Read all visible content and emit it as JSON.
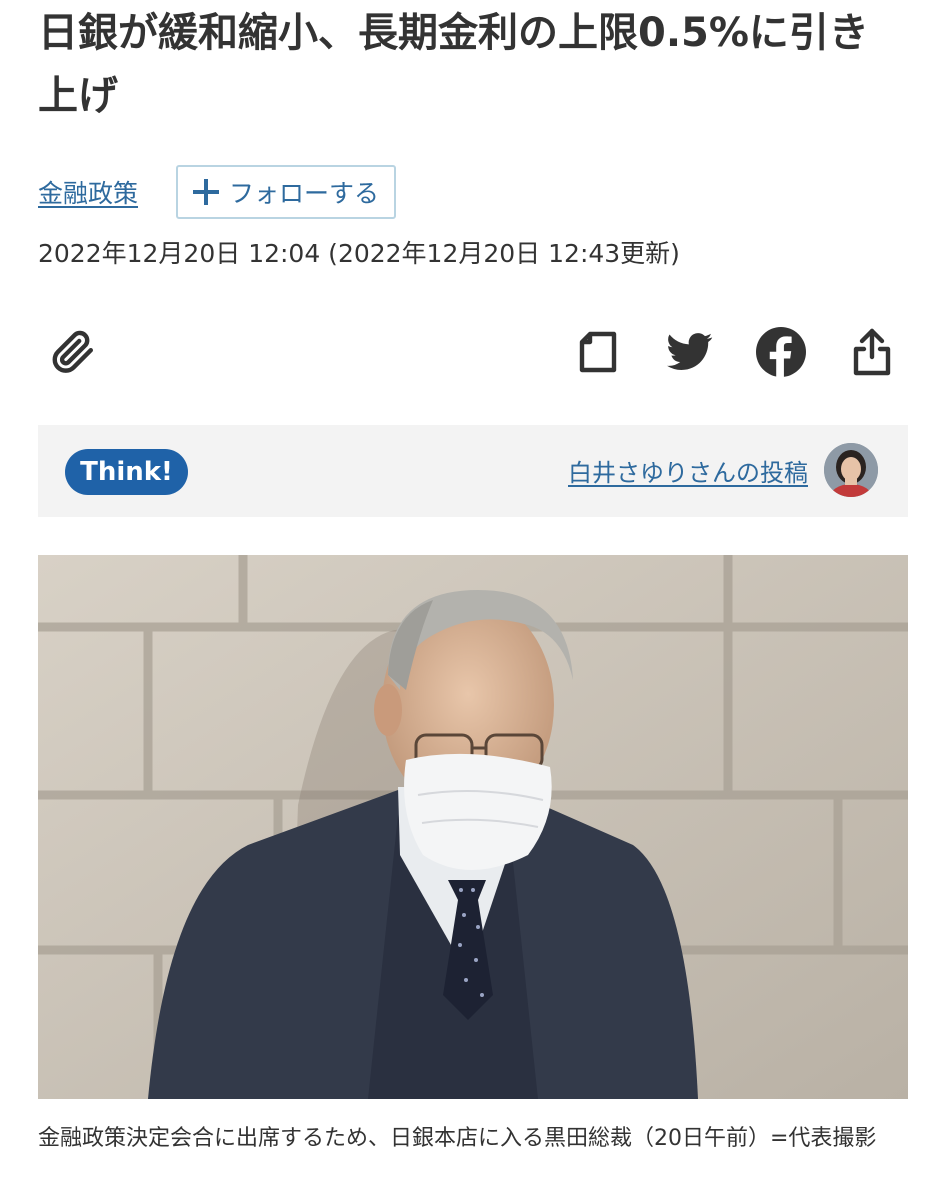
{
  "article": {
    "headline": "日銀が緩和縮小、長期金利の上限0.5%に引き上げ",
    "topic": "金融政策",
    "follow_label": "フォローする",
    "dateline": "2022年12月20日 12:04 (2022年12月20日 12:43更新)"
  },
  "actions": {
    "clip_icon": "paperclip-icon",
    "note_icon": "document-icon",
    "twitter_icon": "twitter-icon",
    "facebook_icon": "facebook-icon",
    "share_icon": "share-icon"
  },
  "think": {
    "badge": "Think!",
    "author_link": "白井さゆりさんの投稿"
  },
  "photo": {
    "caption": "金融政策決定会合に出席するため、日銀本店に入る黒田総裁（20日午前）=代表撮影"
  },
  "colors": {
    "link": "#2e6a9e",
    "badge": "#1f62a8",
    "panel": "#f3f3f3"
  }
}
